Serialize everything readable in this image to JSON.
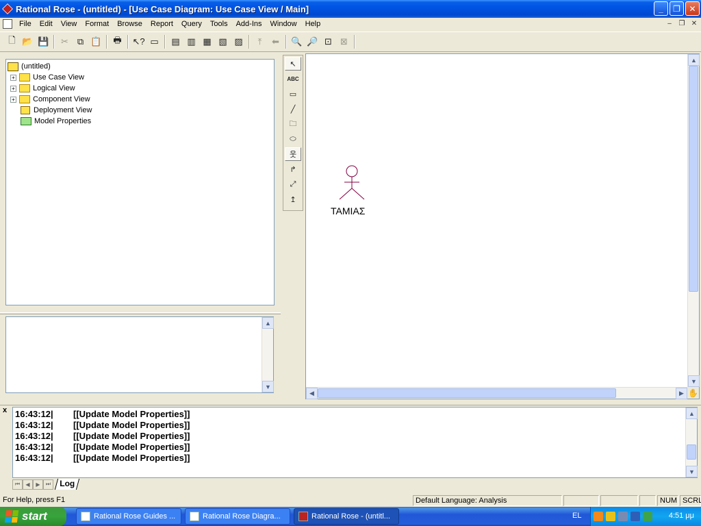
{
  "window": {
    "title": "Rational Rose - (untitled) - [Use Case Diagram: Use Case View / Main]",
    "minimize_label": "_",
    "restore_label": "❐",
    "close_label": "✕"
  },
  "menu": {
    "items": [
      "File",
      "Edit",
      "View",
      "Format",
      "Browse",
      "Report",
      "Query",
      "Tools",
      "Add-Ins",
      "Window",
      "Help"
    ],
    "mdi_minimize": "–",
    "mdi_restore": "❐",
    "mdi_close": "✕"
  },
  "toolbar": {
    "icons": [
      "new-icon",
      "open-icon",
      "save-icon",
      "cut-icon",
      "copy-icon",
      "paste-icon",
      "print-icon",
      "context-help-icon",
      "view-doc-icon",
      "browse-class-icon",
      "browse-interaction-icon",
      "browse-component-icon",
      "browse-deployment-icon",
      "browse-parent-icon",
      "browse-previous-icon",
      "zoom-in-icon",
      "zoom-out-icon",
      "fit-window-icon",
      "undo-fit-icon"
    ]
  },
  "browser": {
    "root": "(untitled)",
    "items": [
      {
        "label": "Use Case View",
        "expandable": true
      },
      {
        "label": "Logical View",
        "expandable": true
      },
      {
        "label": "Component View",
        "expandable": true
      },
      {
        "label": "Deployment View",
        "expandable": false
      },
      {
        "label": "Model Properties",
        "expandable": false
      }
    ],
    "expander_symbol": "+"
  },
  "toolbox": {
    "tools": [
      "selection-arrow-icon",
      "text-box-icon",
      "note-icon",
      "anchor-note-icon",
      "package-icon",
      "use-case-icon",
      "actor-icon",
      "unidirectional-association-icon",
      "dependency-icon",
      "generalization-icon"
    ],
    "text_tool_label": "ABC"
  },
  "diagram": {
    "actor_label": "ΤΑΜΙΑΣ",
    "actor_color": "#800040"
  },
  "log": {
    "lines": [
      {
        "time": "16:43:12|",
        "message": "[[Update Model Properties]]"
      },
      {
        "time": "16:43:12|",
        "message": "[[Update Model Properties]]"
      },
      {
        "time": "16:43:12|",
        "message": "[[Update Model Properties]]"
      },
      {
        "time": "16:43:12|",
        "message": "[[Update Model Properties]]"
      },
      {
        "time": "16:43:12|",
        "message": "[[Update Model Properties]]"
      }
    ],
    "tab_label": "Log",
    "close_label": "x"
  },
  "status": {
    "help": "For Help, press F1",
    "language": "Default Language: Analysis",
    "num": "NUM",
    "scrl": "SCRL"
  },
  "taskbar": {
    "start_label": "start",
    "tasks": [
      {
        "label": "Rational Rose Guides ...",
        "active": false
      },
      {
        "label": "Rational Rose Diagra...",
        "active": false
      },
      {
        "label": "Rational Rose - (untitl...",
        "active": true
      }
    ],
    "lang": "EL",
    "clock": "4:51 μμ"
  }
}
